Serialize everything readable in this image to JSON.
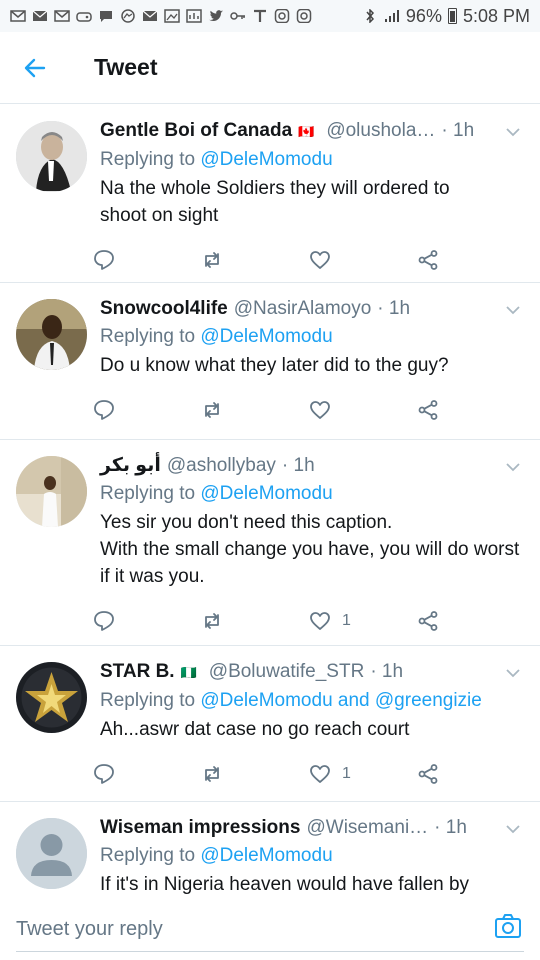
{
  "status_bar": {
    "icons": [
      "bluetooth-icon",
      "signal-icon"
    ],
    "battery": "96%",
    "time": "5:08 PM"
  },
  "header": {
    "title": "Tweet"
  },
  "colors": {
    "accent": "#1da1f2",
    "secondary_text": "#657786",
    "divider": "#e1e8ed"
  },
  "tweets": [
    {
      "name": "Gentle Boi of Canada",
      "badge": "🇨🇦",
      "handle": "@olushola…",
      "time": "· 1h",
      "replying_prefix": "Replying to",
      "replying_to": "@DeleMomodu",
      "text": "Na the whole Soldiers they will ordered to shoot on sight",
      "like_count": ""
    },
    {
      "name": "Snowcool4life",
      "badge": "",
      "handle": "@NasirAlamoyo",
      "time": "· 1h",
      "replying_prefix": "Replying to",
      "replying_to": "@DeleMomodu",
      "text": "Do u know what they later did to the guy?",
      "like_count": ""
    },
    {
      "name": "أبو بكر",
      "badge": "",
      "handle": "@ashollybay",
      "time": "· 1h",
      "replying_prefix": "Replying to",
      "replying_to": "@DeleMomodu",
      "text": "Yes sir you don't  need this caption.\nWith the small change you have,  you will do worst if it was you.",
      "like_count": "1"
    },
    {
      "name": "STAR B.",
      "badge": "🇳🇬",
      "handle": "@Boluwatife_STR",
      "time": "· 1h",
      "replying_prefix": "Replying to",
      "replying_to": "@DeleMomodu and @greengizie",
      "text": "Ah...aswr dat case no go reach court",
      "like_count": "1"
    },
    {
      "name": "Wiseman impressions",
      "badge": "",
      "handle": "@Wisemani…",
      "time": "· 1h",
      "replying_prefix": "Replying to",
      "replying_to": "@DeleMomodu",
      "text": "If it's in Nigeria heaven would have fallen by",
      "like_count": ""
    }
  ],
  "reply_bar": {
    "placeholder": "Tweet your reply"
  }
}
